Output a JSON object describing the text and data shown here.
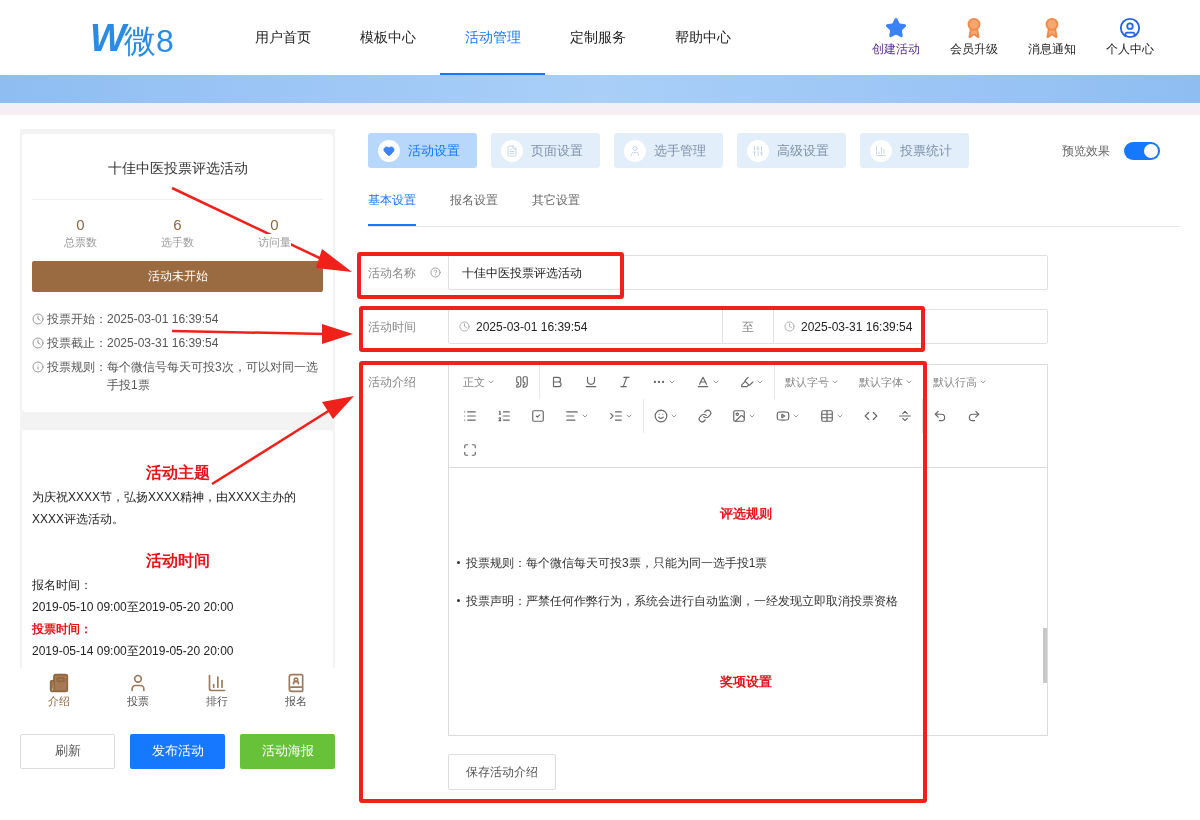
{
  "header": {
    "logo": {
      "mark": "W",
      "text": "微8"
    },
    "nav": [
      {
        "label": "用户首页",
        "selected": false
      },
      {
        "label": "模板中心",
        "selected": false
      },
      {
        "label": "活动管理",
        "selected": true
      },
      {
        "label": "定制服务",
        "selected": false
      },
      {
        "label": "帮助中心",
        "selected": false
      }
    ],
    "actions": [
      {
        "kind": "stars",
        "label": "创建活动"
      },
      {
        "kind": "medal",
        "label": "会员升级"
      },
      {
        "kind": "medal",
        "label": "消息通知"
      },
      {
        "kind": "user",
        "label": "个人中心"
      }
    ]
  },
  "preview": {
    "title": "十佳中医投票评选活动",
    "stats": [
      {
        "value": "0",
        "label": "总票数"
      },
      {
        "value": "6",
        "label": "选手数"
      },
      {
        "value": "0",
        "label": "访问量"
      }
    ],
    "status": "活动未开始",
    "info": [
      {
        "kind": "clock",
        "label": "投票开始：",
        "value": "2025-03-01 16:39:54"
      },
      {
        "kind": "clock",
        "label": "投票截止：",
        "value": "2025-03-31 16:39:54"
      },
      {
        "kind": "rule",
        "label": "投票规则：",
        "value": "每个微信号每天可投3次，可以对同一选手投1票"
      }
    ],
    "content": [
      {
        "kind": "heading",
        "text": "活动主题"
      },
      {
        "kind": "text",
        "text": "为庆祝XXXX节，弘扬XXXX精神，由XXXX主办的XXXX评选活动。"
      },
      {
        "kind": "heading",
        "text": "活动时间"
      },
      {
        "kind": "text",
        "text": "报名时间："
      },
      {
        "kind": "text",
        "text": "2019-05-10 09:00至2019-05-20 20:00"
      },
      {
        "kind": "label",
        "text": "投票时间："
      },
      {
        "kind": "text",
        "text": "2019-05-14 09:00至2019-05-20 20:00"
      }
    ],
    "bottom_nav": [
      {
        "kind": "intro",
        "label": "介绍",
        "selected": true
      },
      {
        "kind": "vote",
        "label": "投票",
        "selected": false
      },
      {
        "kind": "rank",
        "label": "排行",
        "selected": false
      },
      {
        "kind": "signup",
        "label": "报名",
        "selected": false
      }
    ],
    "buttons": [
      {
        "kind": "default",
        "label": "刷新"
      },
      {
        "kind": "primary",
        "label": "发布活动"
      },
      {
        "kind": "success",
        "label": "活动海报"
      }
    ]
  },
  "settings": {
    "tabs": [
      {
        "kind": "heart",
        "label": "活动设置",
        "selected": true
      },
      {
        "kind": "page",
        "label": "页面设置",
        "selected": false
      },
      {
        "kind": "user",
        "label": "选手管理",
        "selected": false
      },
      {
        "kind": "sliders",
        "label": "高级设置",
        "selected": false
      },
      {
        "kind": "chart",
        "label": "投票统计",
        "selected": false
      }
    ],
    "preview_toggle": {
      "label": "预览效果",
      "on": true
    },
    "subtabs": [
      {
        "label": "基本设置",
        "selected": true
      },
      {
        "label": "报名设置",
        "selected": false
      },
      {
        "label": "其它设置",
        "selected": false
      }
    ],
    "name": {
      "label": "活动名称",
      "value": "十佳中医投票评选活动"
    },
    "time": {
      "label": "活动时间",
      "start": "2025-03-01 16:39:54",
      "separator": "至",
      "end": "2025-03-31 16:39:54"
    },
    "intro": {
      "label": "活动介绍",
      "toolbar_menus": [
        "正文",
        "默认字号",
        "默认字体",
        "默认行高"
      ],
      "content": [
        {
          "kind": "heading",
          "text": "评选规则"
        },
        {
          "kind": "bullet",
          "text": "投票规则：每个微信每天可投3票，只能为同一选手投1票"
        },
        {
          "kind": "bullet",
          "text": "投票声明：严禁任何作弊行为，系统会进行自动监测，一经发现立即取消投票资格"
        },
        {
          "kind": "heading",
          "text": "奖项设置"
        }
      ],
      "save": "保存活动介绍"
    }
  }
}
